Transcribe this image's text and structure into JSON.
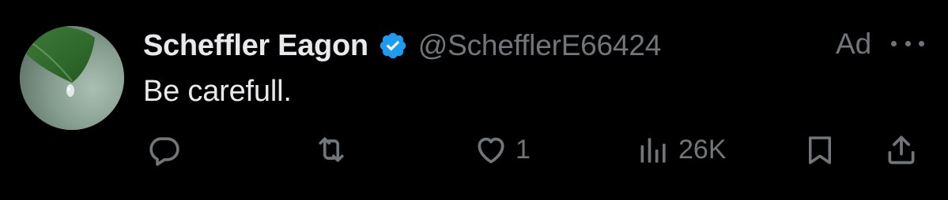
{
  "tweet": {
    "author": {
      "display_name": "Scheffler Eagon",
      "handle": "@SchefflerE66424",
      "verified": true,
      "avatar_icon": "leaf-with-water-drop"
    },
    "ad_label": "Ad",
    "more_icon": "more-horizontal-icon",
    "text": "Be carefull.",
    "actions": {
      "reply": {
        "icon": "reply-icon",
        "count": ""
      },
      "retweet": {
        "icon": "retweet-icon",
        "count": ""
      },
      "like": {
        "icon": "heart-icon",
        "count": "1"
      },
      "views": {
        "icon": "views-icon",
        "count": "26K"
      },
      "bookmark": {
        "icon": "bookmark-icon"
      },
      "share": {
        "icon": "share-icon"
      }
    }
  },
  "colors": {
    "background": "#000000",
    "primary_text": "#e7e9ea",
    "secondary_text": "#71767b",
    "verified_blue": "#1d9bf0"
  }
}
